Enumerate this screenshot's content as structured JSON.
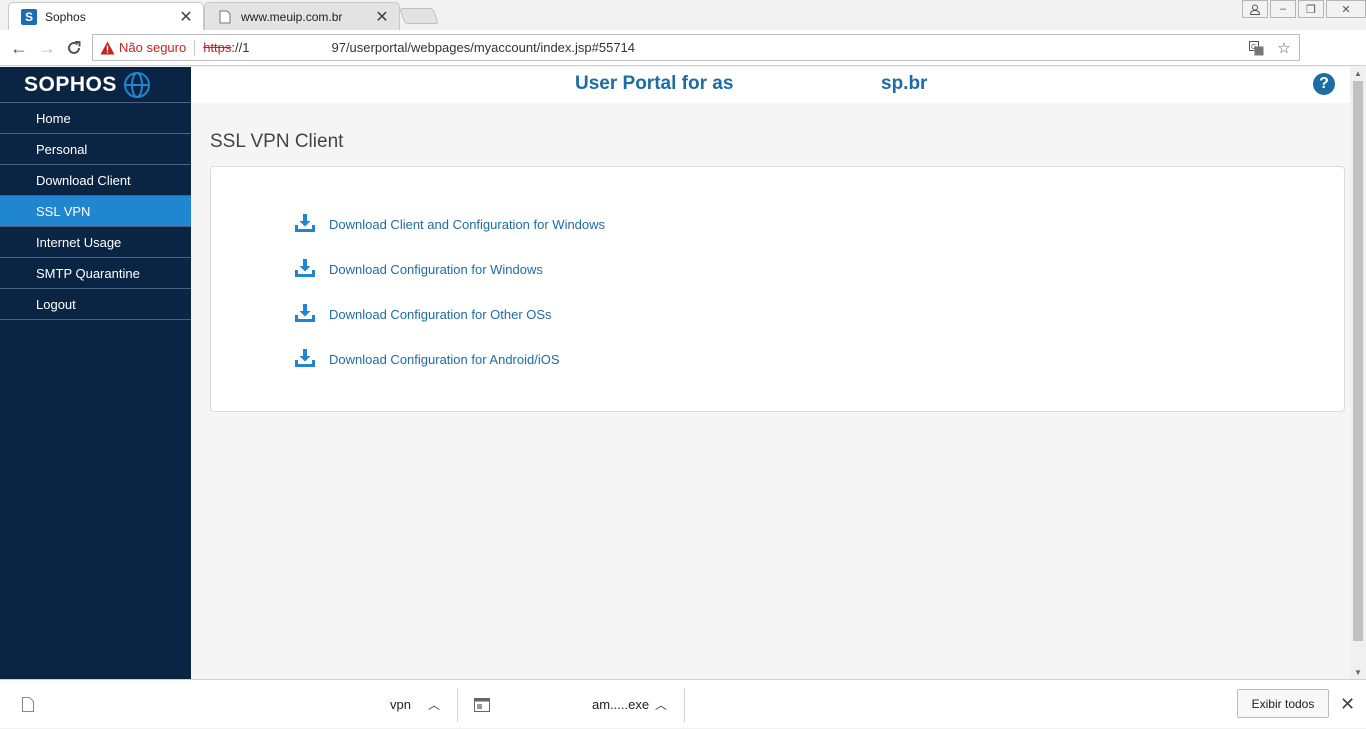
{
  "browser": {
    "tabs": [
      {
        "title": "Sophos",
        "favicon": "sophos-s-icon",
        "active": true
      },
      {
        "title": "www.meuip.com.br",
        "favicon": "page-icon",
        "active": false
      }
    ],
    "address_bar": {
      "security_label": "Não seguro",
      "scheme": "https",
      "url_host": "://1",
      "url_path": "97/userportal/webpages/myaccount/index.jsp#55714"
    }
  },
  "sidebar": {
    "logo_text": "SOPHOS",
    "items": [
      {
        "label": "Home",
        "active": false
      },
      {
        "label": "Personal",
        "active": false
      },
      {
        "label": "Download Client",
        "active": false
      },
      {
        "label": "SSL VPN",
        "active": true
      },
      {
        "label": "Internet Usage",
        "active": false
      },
      {
        "label": "SMTP Quarantine",
        "active": false
      },
      {
        "label": "Logout",
        "active": false
      }
    ]
  },
  "header": {
    "portal_title": "User Portal for as",
    "portal_title_tail": "sp.br"
  },
  "main": {
    "heading": "SSL VPN Client",
    "downloads": [
      {
        "label": "Download Client and Configuration for Windows"
      },
      {
        "label": "Download Configuration for Windows"
      },
      {
        "label": "Download Configuration for Other OSs"
      },
      {
        "label": "Download Configuration for Android/iOS"
      }
    ]
  },
  "download_shelf": {
    "items": [
      {
        "name": "vpn"
      },
      {
        "name": "am.....exe"
      }
    ],
    "show_all_label": "Exibir todos"
  },
  "colors": {
    "sidebar_bg": "#0a2543",
    "active_item": "#1f86cf",
    "link": "#1e6ca5"
  }
}
